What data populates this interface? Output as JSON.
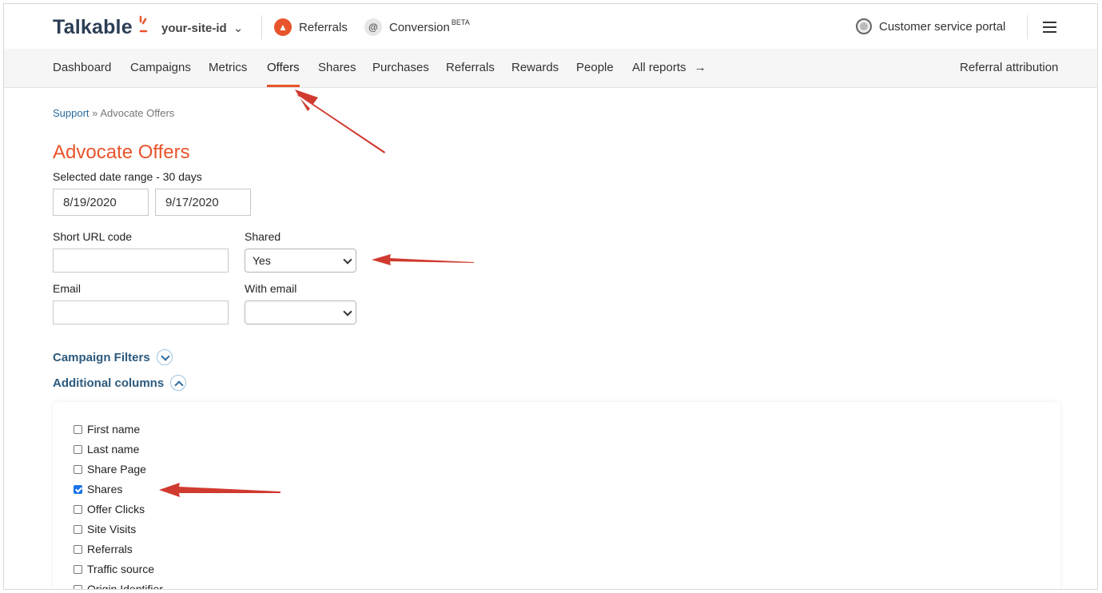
{
  "topbar": {
    "logo": "Talkable",
    "site_id": "your-site-id",
    "products": [
      {
        "label": "Referrals",
        "icon": "referrals-icon"
      },
      {
        "label": "Conversion",
        "badge": "BETA",
        "icon": "at-sign-icon"
      }
    ],
    "portal_label": "Customer service portal"
  },
  "nav": {
    "items": [
      "Dashboard",
      "Campaigns",
      "Metrics",
      "Offers",
      "Shares",
      "Purchases",
      "Referrals",
      "Rewards",
      "People",
      "All reports"
    ],
    "active": "Offers",
    "right_link": "Referral attribution",
    "all_reports_arrow": "→"
  },
  "breadcrumb": {
    "link": "Support",
    "separator": "»",
    "current": "Advocate Offers"
  },
  "page": {
    "title": "Advocate Offers",
    "date_range_label": "Selected date range - 30 days",
    "date_from": "8/19/2020",
    "date_to": "9/17/2020",
    "short_url_label": "Short URL code",
    "short_url_value": "",
    "shared_label": "Shared",
    "shared_value": "Yes",
    "email_label": "Email",
    "email_value": "",
    "with_email_label": "With email",
    "with_email_value": "",
    "campaign_filters": "Campaign Filters",
    "additional_columns": "Additional columns"
  },
  "columns": [
    {
      "label": "First name",
      "checked": false
    },
    {
      "label": "Last name",
      "checked": false
    },
    {
      "label": "Share Page",
      "checked": false
    },
    {
      "label": "Shares",
      "checked": true
    },
    {
      "label": "Offer Clicks",
      "checked": false
    },
    {
      "label": "Site Visits",
      "checked": false
    },
    {
      "label": "Referrals",
      "checked": false
    },
    {
      "label": "Traffic source",
      "checked": false
    },
    {
      "label": "Origin Identifier",
      "checked": false
    }
  ],
  "colors": {
    "accent": "#e8542b",
    "link": "#2c6a9b",
    "arrow": "#d03a2f"
  }
}
